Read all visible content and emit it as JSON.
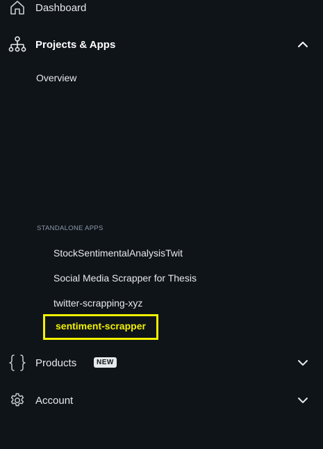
{
  "nav": {
    "dashboard": {
      "label": "Dashboard",
      "icon": "home-icon"
    },
    "projects": {
      "label": "Projects & Apps",
      "icon": "sitemap-icon",
      "expanded": true
    },
    "products": {
      "label": "Products",
      "badge": "NEW",
      "icon": "curly-braces-icon"
    },
    "account": {
      "label": "Account",
      "icon": "gear-icon"
    }
  },
  "projects_menu": {
    "overview": "Overview",
    "standalone_header": "STANDALONE APPS",
    "apps": [
      "StockSentimentalAnalysisTwit",
      "Social Media Scrapper for Thesis",
      "twitter-scrapping-xyz",
      "sentiment-scrapper"
    ],
    "selected_app": "sentiment-scrapper"
  },
  "colors": {
    "background": "#0f1419",
    "text": "#e7e9ea",
    "highlight": "#f2f200",
    "muted": "#8b98a5"
  }
}
